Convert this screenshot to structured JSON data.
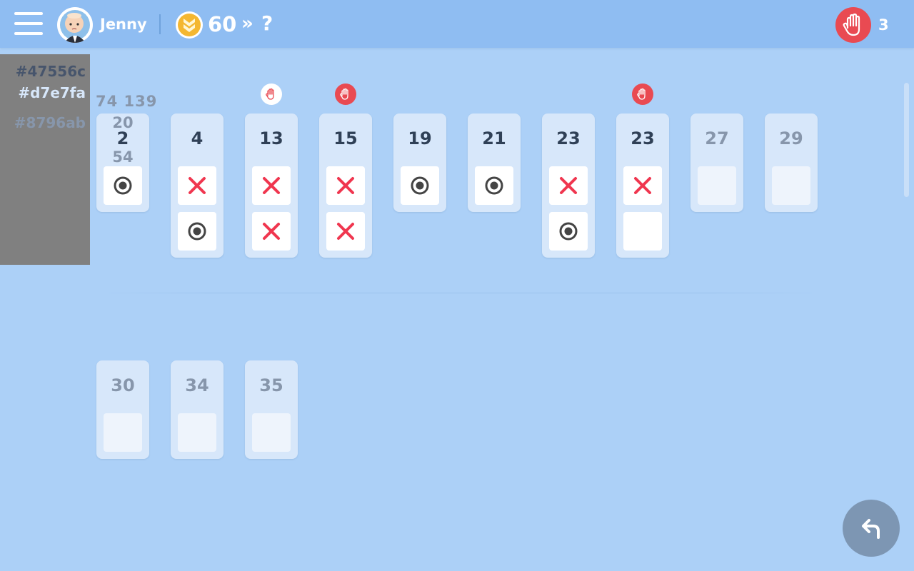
{
  "header": {
    "user_name": "Jenny",
    "coins": "60",
    "coin_arrow": "»",
    "next_level": "?",
    "raised_hands": "3"
  },
  "color_swatches": [
    "#47556c",
    "#d7e7fa",
    "#8796ab"
  ],
  "annotations": {
    "top": "74 139",
    "above": "20",
    "below": "54"
  },
  "columns": [
    {
      "number": "2",
      "state": "active",
      "raised": "",
      "cells": [
        "dot"
      ]
    },
    {
      "number": "4",
      "state": "active",
      "raised": "",
      "cells": [
        "x",
        "dot"
      ]
    },
    {
      "number": "13",
      "state": "active",
      "raised": "white",
      "cells": [
        "x",
        "x"
      ]
    },
    {
      "number": "15",
      "state": "active",
      "raised": "red",
      "cells": [
        "x",
        "x"
      ]
    },
    {
      "number": "19",
      "state": "active",
      "raised": "",
      "cells": [
        "dot"
      ]
    },
    {
      "number": "21",
      "state": "active",
      "raised": "",
      "cells": [
        "dot"
      ]
    },
    {
      "number": "23",
      "state": "active",
      "raised": "",
      "cells": [
        "x",
        "dot"
      ]
    },
    {
      "number": "23",
      "state": "active",
      "raised": "red",
      "cells": [
        "x",
        "blank"
      ]
    },
    {
      "number": "27",
      "state": "future",
      "raised": "",
      "cells": [
        "empty"
      ]
    },
    {
      "number": "29",
      "state": "future",
      "raised": "",
      "cells": [
        "empty"
      ]
    },
    {
      "number": "30",
      "state": "future",
      "raised": "",
      "cells": [
        "empty"
      ]
    },
    {
      "number": "34",
      "state": "future",
      "raised": "",
      "cells": [
        "empty"
      ]
    },
    {
      "number": "35",
      "state": "future",
      "raised": "",
      "cells": [
        "empty"
      ]
    }
  ],
  "colors": {
    "accent_red": "#e94a52",
    "x_mark": "#f0364f",
    "dot_mark": "#444444",
    "coin_gold": "#f4b731"
  },
  "icons": {
    "menu": "hamburger-icon",
    "coin": "coin-icon",
    "raise_hand": "raised-hand-icon",
    "back": "back-arrow-icon"
  }
}
